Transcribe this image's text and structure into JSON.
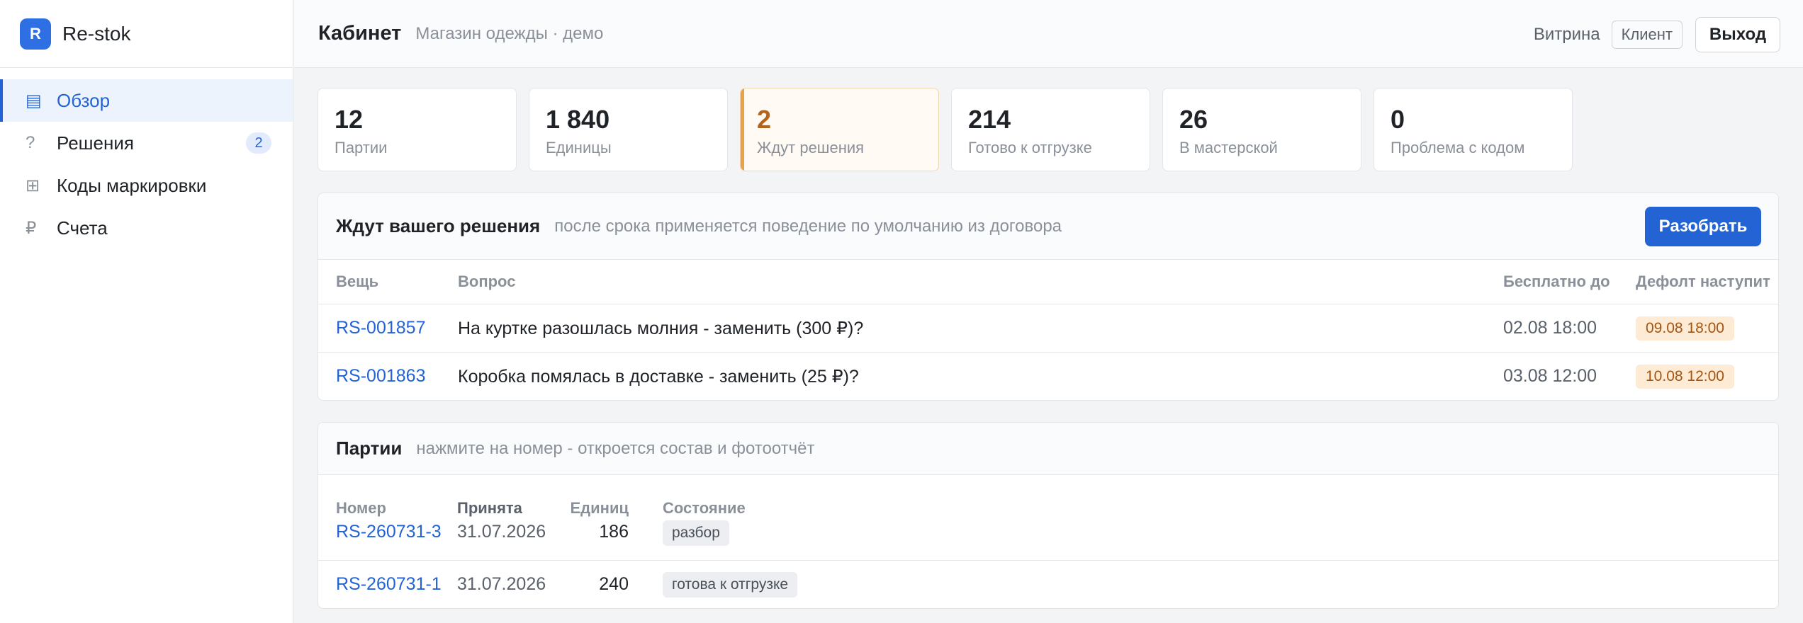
{
  "brand": {
    "logo_letter": "R",
    "name": "Re-stok"
  },
  "sidebar": {
    "items": [
      {
        "icon": "▤",
        "label": "Обзор",
        "active": true
      },
      {
        "icon": "?",
        "label": "Решения",
        "badge": "2"
      },
      {
        "icon": "⊞",
        "label": "Коды маркировки"
      },
      {
        "icon": "₽",
        "label": "Счета"
      }
    ]
  },
  "header": {
    "title": "Кабинет",
    "subtitle": "Магазин одежды · демо",
    "view_label": "Витрина",
    "role": "Клиент",
    "logout": "Выход"
  },
  "stats": [
    {
      "value": "12",
      "label": "Партии"
    },
    {
      "value": "1 840",
      "label": "Единицы"
    },
    {
      "value": "2",
      "label": "Ждут решения"
    },
    {
      "value": "214",
      "label": "Готово к отгрузке"
    },
    {
      "value": "26",
      "label": "В мастерской"
    },
    {
      "value": "0",
      "label": "Проблема с кодом"
    }
  ],
  "decisions": {
    "title": "Ждут вашего решения",
    "hint": "после срока применяется поведение по умолчанию из договора",
    "action": "Разобрать",
    "columns": [
      "Вещь",
      "Вопрос",
      "Бесплатно до",
      "Дефолт наступит"
    ],
    "rows": [
      {
        "item": "RS-001857",
        "question": "На куртке разошлась молния - заменить (300 ₽)?",
        "free_until": "02.08 18:00",
        "default_at": "09.08 18:00"
      },
      {
        "item": "RS-001863",
        "question": "Коробка помялась в доставке - заменить (25 ₽)?",
        "free_until": "03.08 12:00",
        "default_at": "10.08 12:00"
      }
    ]
  },
  "parties": {
    "title": "Партии",
    "hint": "нажмите на номер - откроется состав и фотоотчёт",
    "columns": [
      "Номер",
      "Принята",
      "Единиц",
      "Состояние"
    ],
    "rows": [
      {
        "number": "RS-260731-3",
        "accepted": "31.07.2026",
        "units": "186",
        "state": "разбор"
      },
      {
        "number": "RS-260731-1",
        "accepted": "31.07.2026",
        "units": "240",
        "state": "готова к отгрузке"
      }
    ]
  }
}
